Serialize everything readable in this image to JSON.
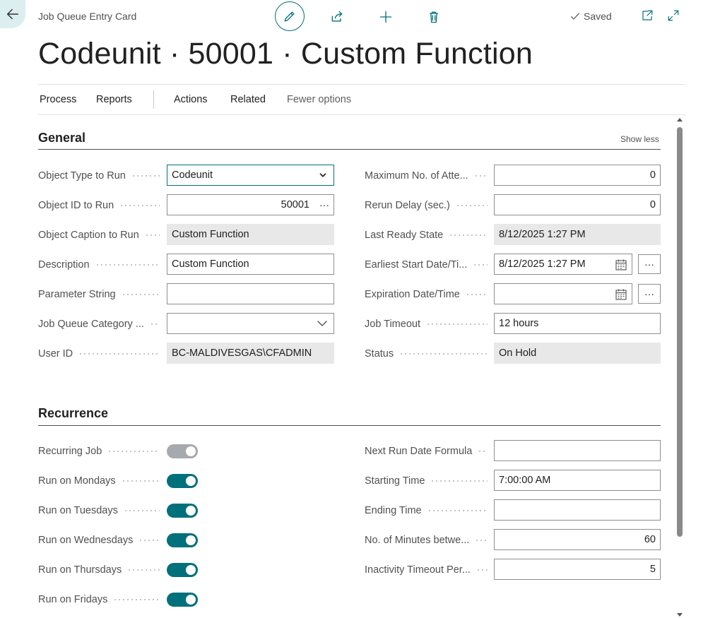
{
  "header": {
    "page_type": "Job Queue Entry Card",
    "saved_label": "Saved",
    "title": "Codeunit · 50001 · Custom Function"
  },
  "actions": {
    "process": "Process",
    "reports": "Reports",
    "actions": "Actions",
    "related": "Related",
    "fewer_options": "Fewer options"
  },
  "general": {
    "title": "General",
    "show_less": "Show less",
    "object_type_label": "Object Type to Run",
    "object_type_value": "Codeunit",
    "object_id_label": "Object ID to Run",
    "object_id_value": "50001",
    "object_caption_label": "Object Caption to Run",
    "object_caption_value": "Custom Function",
    "description_label": "Description",
    "description_value": "Custom Function",
    "parameter_label": "Parameter String",
    "parameter_value": "",
    "category_label": "Job Queue Category ...",
    "category_value": "",
    "user_id_label": "User ID",
    "user_id_value": "BC-MALDIVESGAS\\CFADMIN",
    "max_attempts_label": "Maximum No. of Atte...",
    "max_attempts_value": "0",
    "rerun_delay_label": "Rerun Delay (sec.)",
    "rerun_delay_value": "0",
    "last_ready_label": "Last Ready State",
    "last_ready_value": "8/12/2025 1:27 PM",
    "earliest_start_label": "Earliest Start Date/Ti...",
    "earliest_start_value": "8/12/2025 1:27 PM",
    "expiration_label": "Expiration Date/Time",
    "expiration_value": "",
    "timeout_label": "Job Timeout",
    "timeout_value": "12 hours",
    "status_label": "Status",
    "status_value": "On Hold",
    "ellipsis": "···"
  },
  "recurrence": {
    "title": "Recurrence",
    "recurring_label": "Recurring Job",
    "recurring_on": true,
    "mondays_label": "Run on Mondays",
    "tuesdays_label": "Run on Tuesdays",
    "wednesdays_label": "Run on Wednesdays",
    "thursdays_label": "Run on Thursdays",
    "fridays_label": "Run on Fridays",
    "next_run_label": "Next Run Date Formula",
    "next_run_value": "",
    "starting_time_label": "Starting Time",
    "starting_time_value": "7:00:00 AM",
    "ending_time_label": "Ending Time",
    "ending_time_value": "",
    "minutes_between_label": "No. of Minutes betwe...",
    "minutes_between_value": "60",
    "inactivity_label": "Inactivity Timeout Per...",
    "inactivity_value": "5"
  },
  "colors": {
    "accent": "#00707a",
    "toggle_off": "#a6a9ad",
    "readonly_bg": "#e8e8e8"
  }
}
